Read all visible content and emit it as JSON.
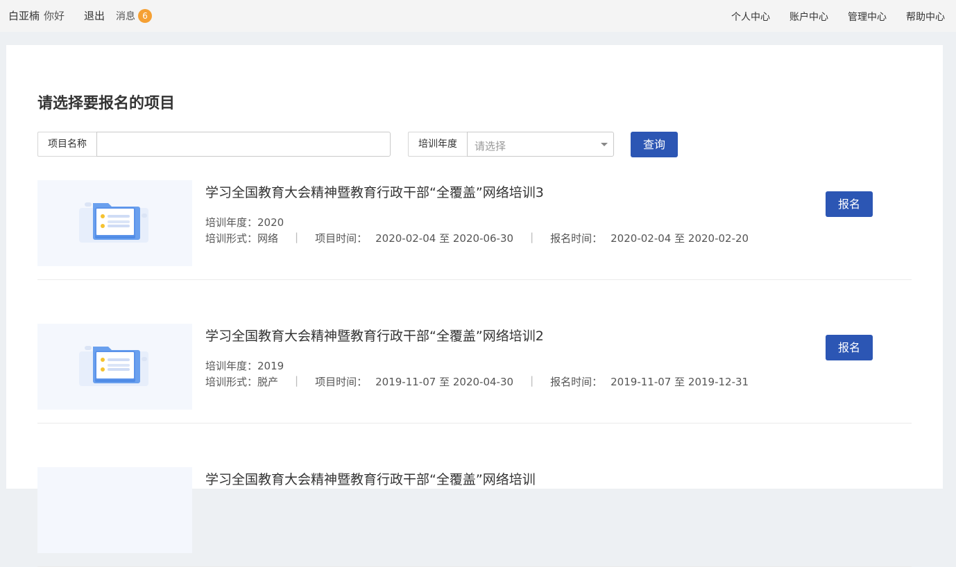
{
  "topbar": {
    "username": "白亚楠",
    "greeting": "你好",
    "logout": "退出",
    "messages_label": "消息",
    "messages_count": "6",
    "nav": [
      "个人中心",
      "账户中心",
      "管理中心",
      "帮助中心"
    ]
  },
  "page": {
    "title": "请选择要报名的项目"
  },
  "filters": {
    "name_label": "项目名称",
    "name_value": "",
    "year_label": "培训年度",
    "year_placeholder": "请选择",
    "search_button": "查询"
  },
  "labels": {
    "year": "培训年度：",
    "form": "培训形式：",
    "project_time": "项目时间：",
    "signup_time": "报名时间：",
    "to": "至",
    "enroll": "报名"
  },
  "projects": [
    {
      "title": "学习全国教育大会精神暨教育行政干部“全覆盖”网络培训3",
      "year": "2020",
      "form": "网络",
      "project_start": "2020-02-04",
      "project_end": "2020-06-30",
      "signup_start": "2020-02-04",
      "signup_end": "2020-02-20"
    },
    {
      "title": "学习全国教育大会精神暨教育行政干部“全覆盖”网络培训2",
      "year": "2019",
      "form": "脱产",
      "project_start": "2019-11-07",
      "project_end": "2020-04-30",
      "signup_start": "2019-11-07",
      "signup_end": "2019-12-31"
    },
    {
      "title": "学习全国教育大会精神暨教育行政干部“全覆盖”网络培训"
    }
  ],
  "colors": {
    "primary": "#2c56b4",
    "badge": "#f5a033",
    "topbar_bg": "#f4f4f4",
    "page_bg": "#edf0f3"
  },
  "icons": {
    "thumbnail": "folder-list-icon",
    "dropdown": "caret-down-icon"
  }
}
